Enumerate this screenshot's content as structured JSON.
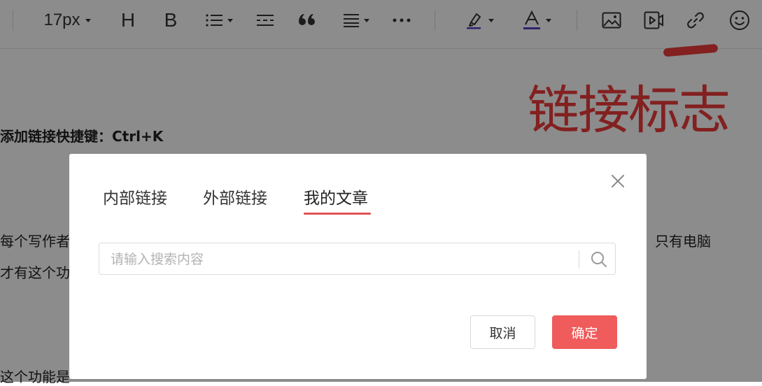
{
  "toolbar": {
    "font_size": "17px",
    "heading_label": "H",
    "bold_label": "B",
    "icons": [
      "list-icon",
      "divider-icon",
      "quote-icon",
      "align-icon",
      "more-icon",
      "highlight-icon",
      "font-color-icon",
      "image-icon",
      "video-icon",
      "link-icon",
      "emoji-icon"
    ],
    "font_color": "#5b3fc8"
  },
  "content": {
    "shortcut_line": "添加链接快捷键：Ctrl+K",
    "para1_start": "每个写作者",
    "para1_end": "只有电脑",
    "para2_start": "才有这个功",
    "para3_start": "这个功能是"
  },
  "annotation": {
    "text": "链接标志",
    "color": "#ee3b3b"
  },
  "dialog": {
    "tabs": [
      {
        "label": "内部链接",
        "active": false
      },
      {
        "label": "外部链接",
        "active": false
      },
      {
        "label": "我的文章",
        "active": true
      }
    ],
    "search_placeholder": "请输入搜索内容",
    "search_value": "",
    "cancel_label": "取消",
    "ok_label": "确定",
    "accent_color": "#f05b5b"
  }
}
